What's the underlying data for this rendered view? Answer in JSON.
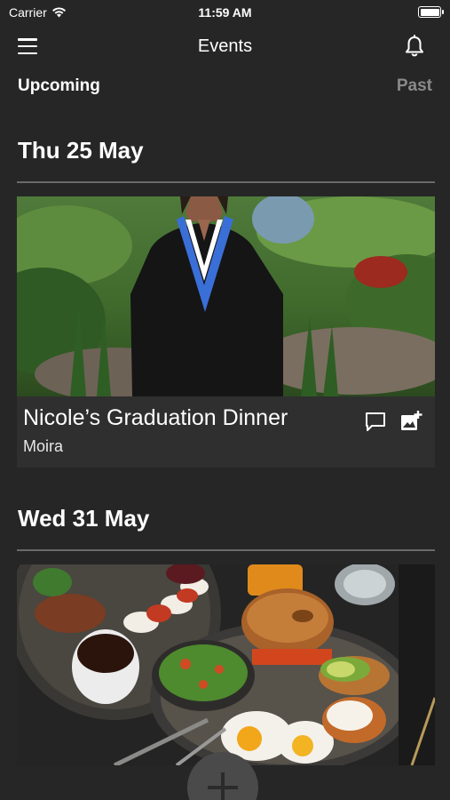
{
  "status_bar": {
    "carrier": "Carrier",
    "time": "11:59 AM"
  },
  "nav": {
    "title": "Events",
    "menu_icon": "menu-icon",
    "bell_icon": "bell-icon"
  },
  "segments": {
    "upcoming": "Upcoming",
    "past": "Past",
    "selected": "Upcoming"
  },
  "events": [
    {
      "date": "Thu 25 May",
      "title": "Nicole’s Graduation Dinner",
      "host": "Moira",
      "photo": "graduate in black gown with blue and white stole standing in a garden",
      "actions": [
        "comment-icon",
        "add-photo-icon"
      ]
    },
    {
      "date": "Wed 31 May",
      "photo": "brunch table with bagel, fried eggs, avocado, salad, coffee and caprese plate"
    }
  ],
  "fab": {
    "icon": "plus-icon"
  },
  "colors": {
    "background": "#262626",
    "card": "#2f2f2f",
    "divider": "#6a6a6a",
    "muted": "#8a8a8a",
    "accent_stole": "#3a6fd8"
  }
}
